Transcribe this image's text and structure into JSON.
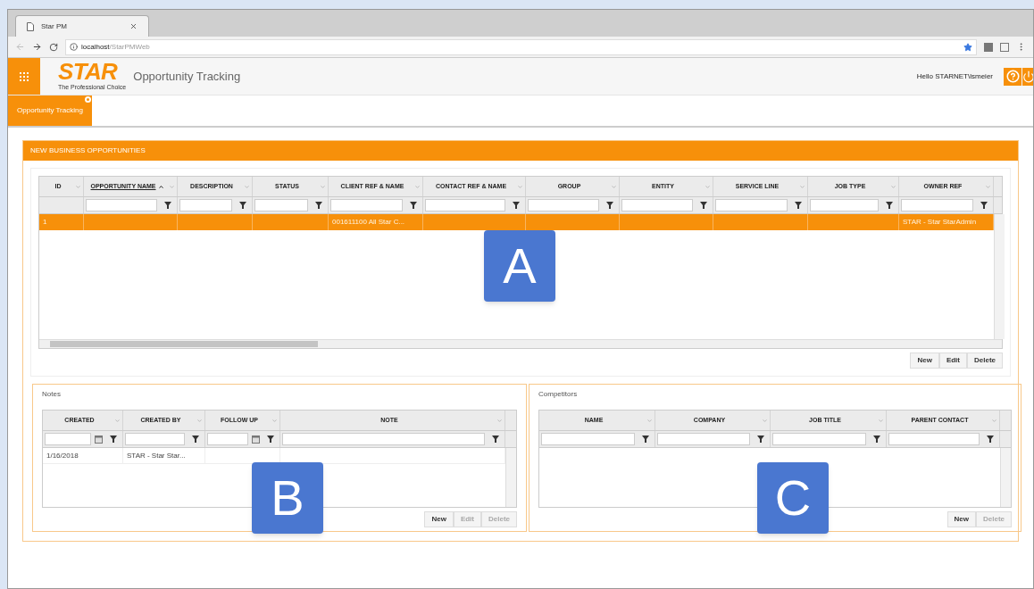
{
  "browser": {
    "tab_title": "Star PM",
    "url_host": "localhost",
    "url_path": "/StarPMWeb"
  },
  "header": {
    "logo": "STAR",
    "tagline": "The Professional Choice",
    "app_title": "Opportunity Tracking",
    "greeting": "Hello STARNET\\lsmeier"
  },
  "app_tabs": [
    {
      "label": "Opportunity Tracking",
      "selected": true
    }
  ],
  "opportunities": {
    "title": "NEW BUSINESS OPPORTUNITIES",
    "columns": [
      {
        "label": "ID",
        "sorted": false,
        "kind": "plain"
      },
      {
        "label": "OPPORTUNITY NAME",
        "sorted": true,
        "kind": "text"
      },
      {
        "label": "DESCRIPTION",
        "sorted": false,
        "kind": "text"
      },
      {
        "label": "STATUS",
        "sorted": false,
        "kind": "text"
      },
      {
        "label": "CLIENT REF & NAME",
        "sorted": false,
        "kind": "text"
      },
      {
        "label": "CONTACT REF & NAME",
        "sorted": false,
        "kind": "text"
      },
      {
        "label": "GROUP",
        "sorted": false,
        "kind": "text"
      },
      {
        "label": "ENTITY",
        "sorted": false,
        "kind": "text"
      },
      {
        "label": "SERVICE LINE",
        "sorted": false,
        "kind": "text"
      },
      {
        "label": "JOB TYPE",
        "sorted": false,
        "kind": "text"
      },
      {
        "label": "OWNER REF",
        "sorted": false,
        "kind": "text"
      }
    ],
    "rows": [
      {
        "selected": true,
        "cells": [
          "1",
          "",
          "",
          "",
          "001611100 All Star C...",
          "",
          "",
          "",
          "",
          "",
          "STAR - Star StarAdmin"
        ]
      }
    ],
    "buttons": [
      {
        "label": "New",
        "disabled": false
      },
      {
        "label": "Edit",
        "disabled": false
      },
      {
        "label": "Delete",
        "disabled": false
      }
    ]
  },
  "notes": {
    "title": "Notes",
    "columns": [
      {
        "label": "CREATED",
        "sorted": false,
        "kind": "date"
      },
      {
        "label": "CREATED BY",
        "sorted": false,
        "kind": "text"
      },
      {
        "label": "FOLLOW UP",
        "sorted": false,
        "kind": "date"
      },
      {
        "label": "NOTE",
        "sorted": false,
        "kind": "text"
      }
    ],
    "rows": [
      {
        "selected": false,
        "cells": [
          "1/16/2018",
          "STAR - Star Star...",
          "",
          ""
        ]
      }
    ],
    "buttons": [
      {
        "label": "New",
        "disabled": false
      },
      {
        "label": "Edit",
        "disabled": true
      },
      {
        "label": "Delete",
        "disabled": true
      }
    ]
  },
  "competitors": {
    "title": "Competitors",
    "columns": [
      {
        "label": "NAME",
        "sorted": false,
        "kind": "text"
      },
      {
        "label": "COMPANY",
        "sorted": false,
        "kind": "text"
      },
      {
        "label": "JOB TITLE",
        "sorted": false,
        "kind": "text"
      },
      {
        "label": "PARENT CONTACT",
        "sorted": false,
        "kind": "text"
      }
    ],
    "buttons": [
      {
        "label": "New",
        "disabled": false
      },
      {
        "label": "Delete",
        "disabled": true
      }
    ]
  },
  "callouts": [
    "A",
    "B",
    "C"
  ]
}
